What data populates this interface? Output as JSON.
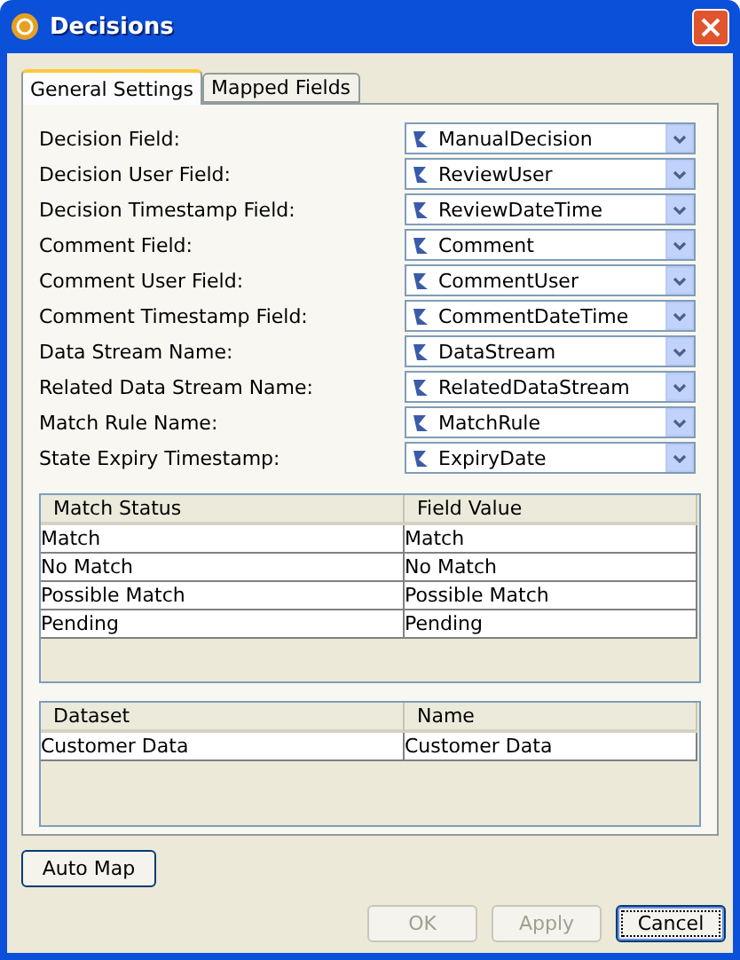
{
  "window": {
    "title": "Decisions"
  },
  "tabs": [
    {
      "label": "General Settings",
      "selected": true
    },
    {
      "label": "Mapped Fields",
      "selected": false
    }
  ],
  "fields": [
    {
      "label": "Decision Field:",
      "value": "ManualDecision"
    },
    {
      "label": "Decision User Field:",
      "value": "ReviewUser"
    },
    {
      "label": "Decision Timestamp Field:",
      "value": "ReviewDateTime"
    },
    {
      "label": "Comment Field:",
      "value": "Comment"
    },
    {
      "label": "Comment User Field:",
      "value": "CommentUser"
    },
    {
      "label": "Comment Timestamp Field:",
      "value": "CommentDateTime"
    },
    {
      "label": "Data Stream Name:",
      "value": "DataStream"
    },
    {
      "label": "Related Data Stream Name:",
      "value": "RelatedDataStream"
    },
    {
      "label": "Match Rule Name:",
      "value": "MatchRule"
    },
    {
      "label": "State Expiry Timestamp:",
      "value": "ExpiryDate"
    }
  ],
  "status_table": {
    "columns": [
      "Match Status",
      "Field Value"
    ],
    "rows": [
      [
        "Match",
        "Match"
      ],
      [
        "No Match",
        "No Match"
      ],
      [
        "Possible Match",
        "Possible Match"
      ],
      [
        "Pending",
        "Pending"
      ]
    ]
  },
  "dataset_table": {
    "columns": [
      "Dataset",
      "Name"
    ],
    "rows": [
      [
        "Customer Data",
        "Customer Data"
      ]
    ]
  },
  "auto_map_button": {
    "label": "Auto Map"
  },
  "buttons": [
    {
      "label": "OK",
      "disabled": true,
      "default": false
    },
    {
      "label": "Apply",
      "disabled": true,
      "default": false
    },
    {
      "label": "Cancel",
      "disabled": false,
      "default": true
    }
  ]
}
